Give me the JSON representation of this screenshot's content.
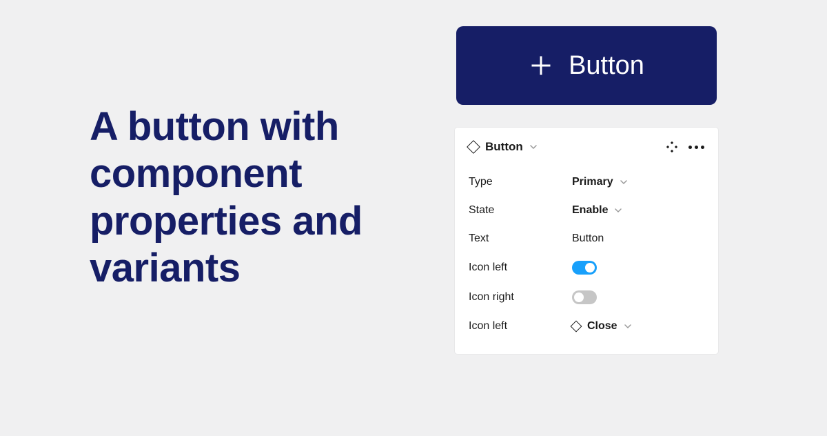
{
  "headline": "A button with component properties and variants",
  "preview": {
    "label": "Button"
  },
  "panel": {
    "title": "Button",
    "properties": {
      "type": {
        "label": "Type",
        "value": "Primary"
      },
      "state": {
        "label": "State",
        "value": "Enable"
      },
      "text": {
        "label": "Text",
        "value": "Button"
      },
      "iconLeft": {
        "label": "Icon left",
        "on": true
      },
      "iconRight": {
        "label": "Icon right",
        "on": false
      },
      "iconLeftSwap": {
        "label": "Icon left",
        "value": "Close"
      }
    }
  }
}
